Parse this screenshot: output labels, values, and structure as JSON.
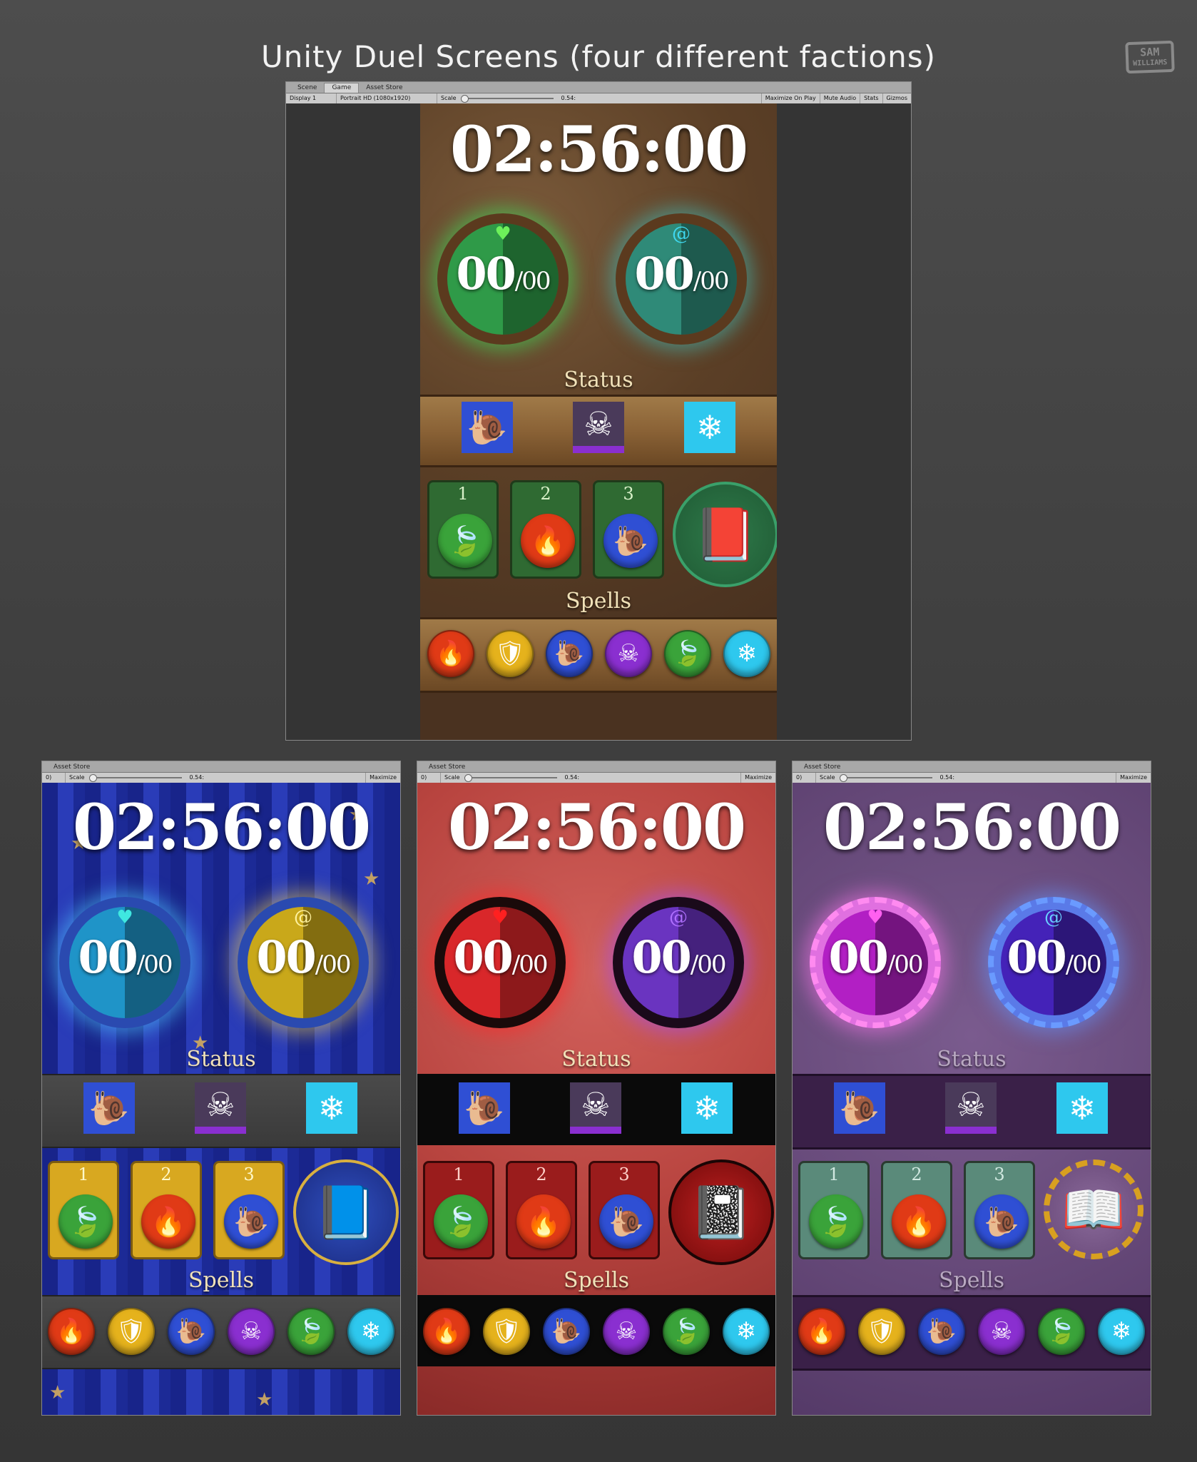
{
  "page_title": "Unity Duel Screens (four different factions)",
  "logo": {
    "line1": "SAM",
    "line2": "WILLIAMS"
  },
  "editor_main": {
    "tabs": [
      "Scene",
      "Game",
      "Asset Store"
    ],
    "toolbar": {
      "display": "Display 1",
      "resolution": "Portrait HD (1080x1920)",
      "scale_label": "Scale",
      "scale_value": "0.54:",
      "maximize": "Maximize On Play",
      "mute": "Mute Audio",
      "stats": "Stats",
      "gizmos": "Gizmos"
    }
  },
  "editor_small": {
    "tab": "Asset Store",
    "left_stub": "0)",
    "scale_label": "Scale",
    "scale_value": "0.54:",
    "maximize": "Maximize"
  },
  "game": {
    "timer": "02:56:00",
    "health": {
      "value": "00",
      "max": "/00"
    },
    "mana": {
      "value": "00",
      "max": "/00"
    },
    "status_label": "Status",
    "spells_label": "Spells",
    "slots": [
      "1",
      "2",
      "3"
    ],
    "icons": {
      "heart": "♥",
      "swirl": "@",
      "snail": "snail",
      "skull": "☠",
      "snowflake": "❄",
      "leaf": "leaf",
      "fire": "fire",
      "shield": "shield",
      "book": "book"
    }
  },
  "colors": {
    "snail": "#2f4fd4",
    "skull": "#8a2fd0",
    "snowflake": "#2ec8ee",
    "leaf": "#3aa33a",
    "fire": "#e03a16",
    "shield": "#e5b21c",
    "nature_health": "#2f9a48",
    "nature_mana": "#2f8a78",
    "arcane_health": "#1f94c8",
    "arcane_mana": "#c9a81a",
    "chaos_health": "#d9272a",
    "chaos_mana": "#6a34c0",
    "tech_health": "#b21fc4",
    "tech_mana": "#4422b8"
  }
}
